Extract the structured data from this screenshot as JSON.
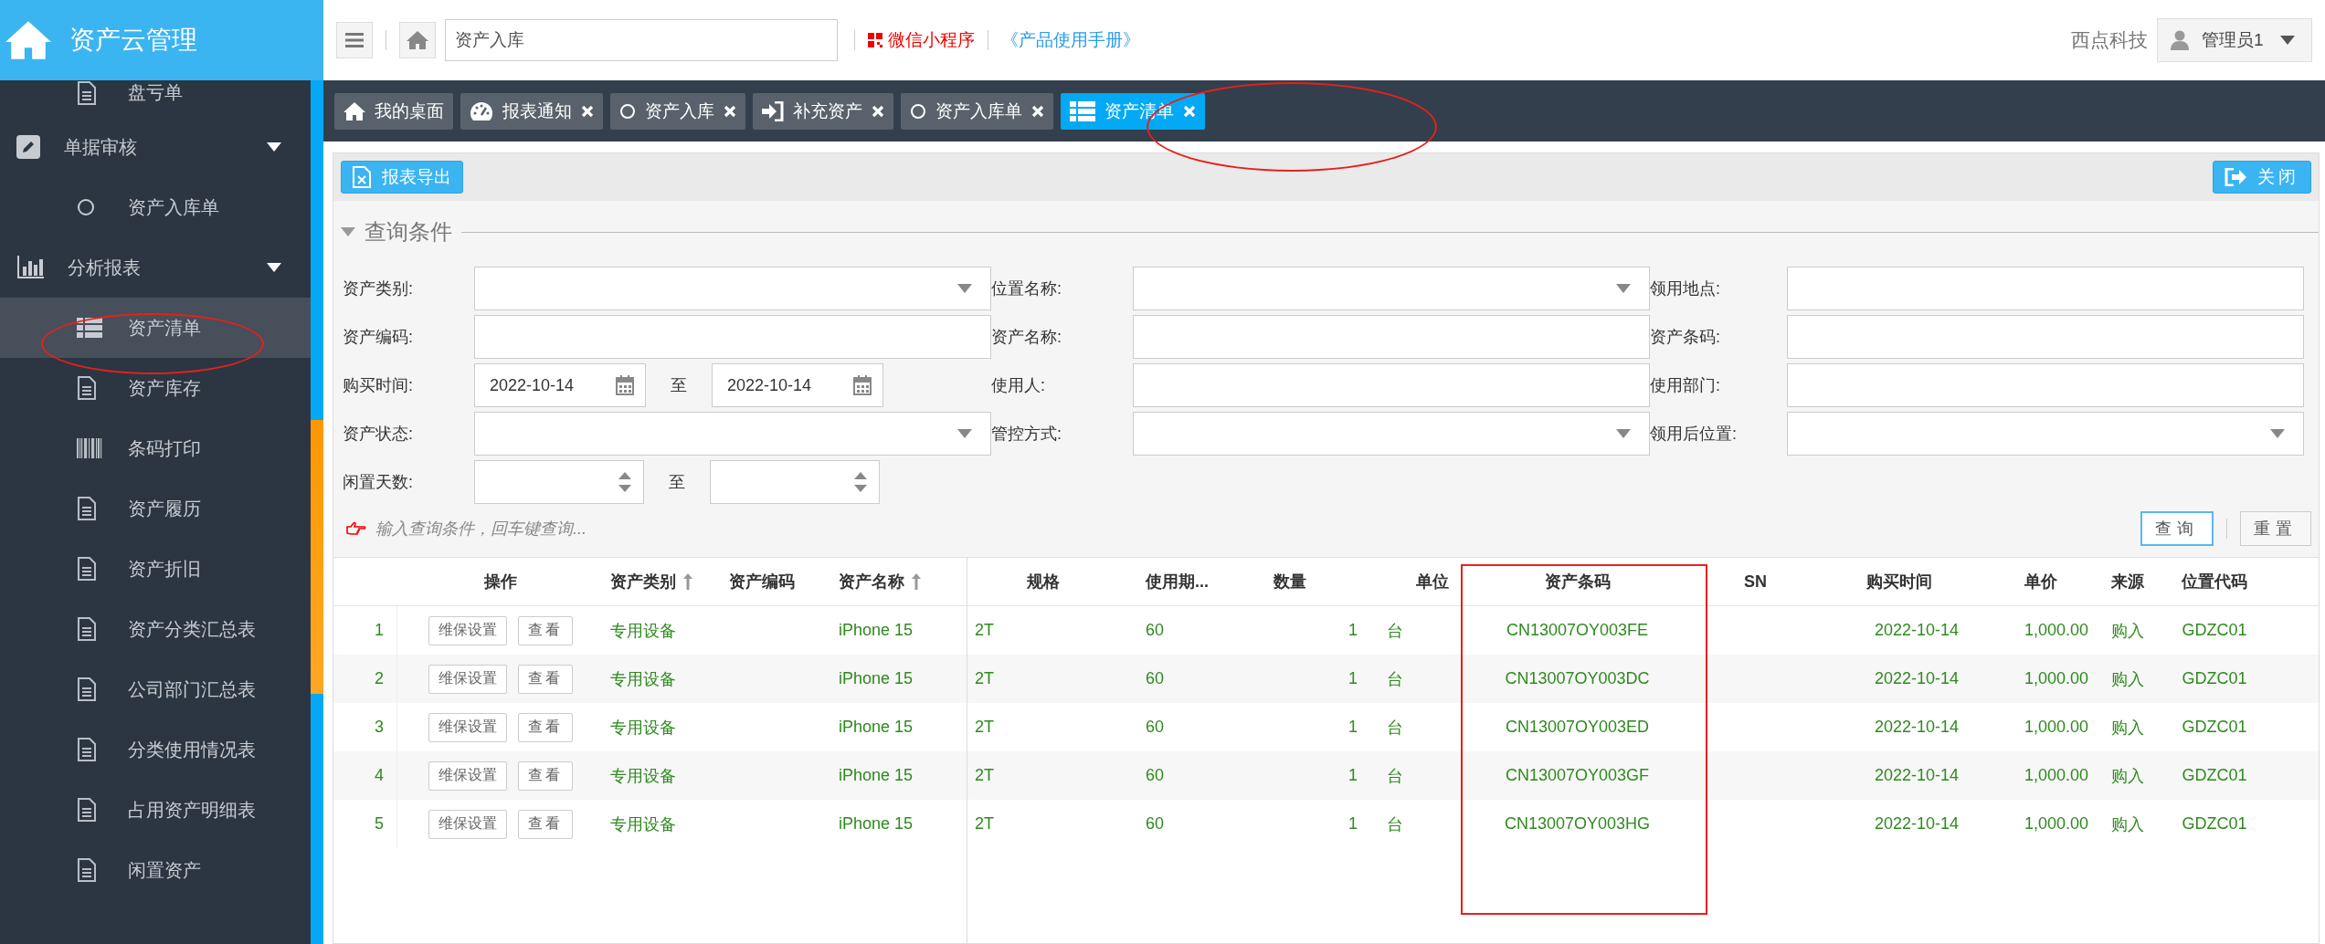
{
  "app": {
    "title": "资产云管理"
  },
  "sidebar": {
    "items": [
      {
        "kind": "item",
        "label": "盘亏单",
        "selected": false
      },
      {
        "kind": "group",
        "label": "单据审核",
        "selected": false,
        "expanded": true,
        "children": [
          {
            "label": "资产入库单",
            "selected": false
          }
        ]
      },
      {
        "kind": "group",
        "label": "分析报表",
        "selected": false,
        "expanded": true,
        "children": [
          {
            "label": "资产清单",
            "selected": true
          },
          {
            "label": "资产库存",
            "selected": false
          },
          {
            "label": "条码打印",
            "selected": false
          },
          {
            "label": "资产履历",
            "selected": false
          },
          {
            "label": "资产折旧",
            "selected": false
          },
          {
            "label": "资产分类汇总表",
            "selected": false
          },
          {
            "label": "公司部门汇总表",
            "selected": false
          },
          {
            "label": "分类使用情况表",
            "selected": false
          },
          {
            "label": "占用资产明细表",
            "selected": false
          },
          {
            "label": "闲置资产",
            "selected": false
          }
        ]
      }
    ]
  },
  "topbar": {
    "search": {
      "value": "资产入库"
    },
    "links": [
      {
        "label": "微信小程序",
        "kind": "miniapp"
      },
      {
        "label": "《产品使用手册》",
        "kind": "manual"
      }
    ],
    "company": "西点科技",
    "user": "管理员1"
  },
  "tabs": [
    {
      "label": "我的桌面",
      "selected": false,
      "closable": false
    },
    {
      "label": "报表通知",
      "selected": false,
      "closable": true
    },
    {
      "label": "资产入库",
      "selected": false,
      "closable": true
    },
    {
      "label": "补充资产",
      "selected": false,
      "closable": true
    },
    {
      "label": "资产入库单",
      "selected": false,
      "closable": true
    },
    {
      "label": "资产清单",
      "selected": true,
      "closable": true
    }
  ],
  "toolbar": {
    "export": "报表导出",
    "close": "关闭"
  },
  "query": {
    "title": "查询条件",
    "expanded": true,
    "rows": [
      [
        {
          "label": "资产类别:",
          "kind": "select"
        },
        {
          "label": "位置名称:",
          "kind": "select"
        },
        {
          "label": "领用地点:",
          "kind": "text"
        }
      ],
      [
        {
          "label": "资产编码:",
          "kind": "text"
        },
        {
          "label": "资产名称:",
          "kind": "text"
        },
        {
          "label": "资产条码:",
          "kind": "text"
        }
      ],
      [
        {
          "label": "购买时间:",
          "kind": "date_range",
          "from": "2022-10-14",
          "separator": "至",
          "to": "2022-10-14"
        },
        {
          "label": "使用人:",
          "kind": "text"
        },
        {
          "label": "使用部门:",
          "kind": "text"
        }
      ],
      [
        {
          "label": "资产状态:",
          "kind": "select"
        },
        {
          "label": "管控方式:",
          "kind": "select"
        },
        {
          "label": "领用后位置:",
          "kind": "select"
        }
      ],
      [
        {
          "label": "闲置天数:",
          "kind": "number_range",
          "separator": "至"
        }
      ]
    ],
    "hint": "输入查询条件，回车键查询...",
    "buttons": [
      {
        "label": "查询",
        "kind": "primary"
      },
      {
        "label": "重置",
        "kind": "default"
      }
    ]
  },
  "table": {
    "columns": [
      {
        "label": "操作",
        "sortable": false
      },
      {
        "label": "资产类别",
        "sortable": true
      },
      {
        "label": "资产编码",
        "sortable": false
      },
      {
        "label": "资产名称",
        "sortable": true
      },
      {
        "label": "规格",
        "sortable": false
      },
      {
        "label": "使用期...",
        "sortable": false
      },
      {
        "label": "数量",
        "sortable": false
      },
      {
        "label": "单位",
        "sortable": false
      },
      {
        "label": "资产条码",
        "sortable": false
      },
      {
        "label": "SN",
        "sortable": false
      },
      {
        "label": "购买时间",
        "sortable": false
      },
      {
        "label": "单价",
        "sortable": false
      },
      {
        "label": "来源",
        "sortable": false
      },
      {
        "label": "位置代码",
        "sortable": false
      }
    ],
    "rows": [
      {
        "index": "1",
        "actions": [
          "维保设置",
          "查看"
        ],
        "category": "专用设备",
        "name": "iPhone 15",
        "spec": "2T",
        "period": "60",
        "qty": "1",
        "unit": "台",
        "barcode": "CN13007OY003FE",
        "date": "2022-10-14",
        "price": "1,000.00",
        "source": "购入",
        "location_code": "GDZC01"
      },
      {
        "index": "2",
        "actions": [
          "维保设置",
          "查看"
        ],
        "category": "专用设备",
        "name": "iPhone 15",
        "spec": "2T",
        "period": "60",
        "qty": "1",
        "unit": "台",
        "barcode": "CN13007OY003DC",
        "date": "2022-10-14",
        "price": "1,000.00",
        "source": "购入",
        "location_code": "GDZC01"
      },
      {
        "index": "3",
        "actions": [
          "维保设置",
          "查看"
        ],
        "category": "专用设备",
        "name": "iPhone 15",
        "spec": "2T",
        "period": "60",
        "qty": "1",
        "unit": "台",
        "barcode": "CN13007OY003ED",
        "date": "2022-10-14",
        "price": "1,000.00",
        "source": "购入",
        "location_code": "GDZC01"
      },
      {
        "index": "4",
        "actions": [
          "维保设置",
          "查看"
        ],
        "category": "专用设备",
        "name": "iPhone 15",
        "spec": "2T",
        "period": "60",
        "qty": "1",
        "unit": "台",
        "barcode": "CN13007OY003GF",
        "date": "2022-10-14",
        "price": "1,000.00",
        "source": "购入",
        "location_code": "GDZC01"
      },
      {
        "index": "5",
        "actions": [
          "维保设置",
          "查看"
        ],
        "category": "专用设备",
        "name": "iPhone 15",
        "spec": "2T",
        "period": "60",
        "qty": "1",
        "unit": "台",
        "barcode": "CN13007OY003HG",
        "date": "2022-10-14",
        "price": "1,000.00",
        "source": "购入",
        "location_code": "GDZC01"
      }
    ]
  }
}
